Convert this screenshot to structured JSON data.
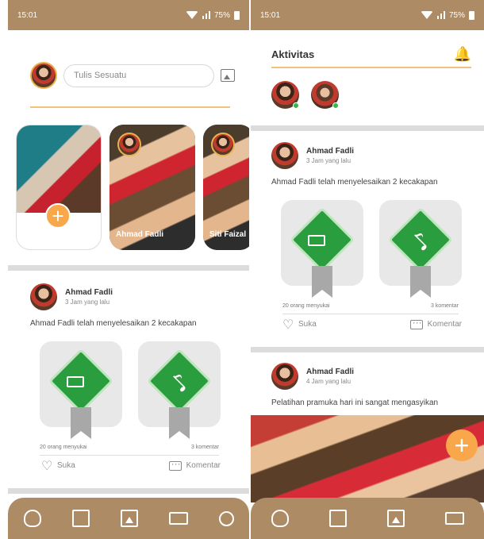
{
  "left": {
    "status": {
      "time": "15:01",
      "battery": "75%"
    },
    "composer": {
      "placeholder": "Tulis Sesuatu"
    },
    "stories": [
      {
        "name": "",
        "type": "mine"
      },
      {
        "name": "Ahmad Fadli",
        "type": "friend"
      },
      {
        "name": "Siti Faizal",
        "type": "friend"
      }
    ],
    "post": {
      "author": "Ahmad Fadli",
      "time": "3 Jam yang lalu",
      "text": "Ahmad Fadli telah menyelesaikan 2 kecakapan",
      "likes": "20 orang menyukai",
      "comments": "3 komentar",
      "like_label": "Suka",
      "comment_label": "Komentar"
    },
    "nav": [
      "medal-icon",
      "news-icon",
      "image-icon",
      "chat-icon",
      "gear-icon"
    ]
  },
  "right": {
    "status": {
      "time": "15:01",
      "battery": "75%"
    },
    "header": {
      "title": "Aktivitas"
    },
    "post1": {
      "author": "Ahmad Fadli",
      "time": "3 Jam yang lalu",
      "text": "Ahmad Fadli telah menyelesaikan 2 kecakapan",
      "likes": "20 orang menyukai",
      "comments": "3 komentar",
      "like_label": "Suka",
      "comment_label": "Komentar"
    },
    "post2": {
      "author": "Ahmad Fadli",
      "time": "4 Jam yang lalu",
      "text": "Pelatihan pramuka hari ini sangat mengasyikan"
    },
    "nav": [
      "medal-icon",
      "news-icon",
      "image-icon",
      "chat-icon"
    ]
  },
  "colors": {
    "brand": "#ad8b64",
    "accent": "#f8a84b",
    "badge": "#2a9e3e"
  }
}
